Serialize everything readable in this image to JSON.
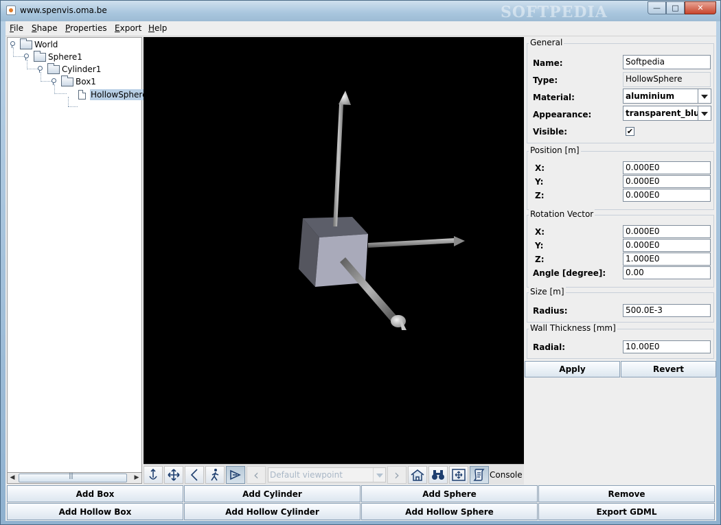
{
  "window": {
    "title": "www.spenvis.oma.be",
    "watermark": "SOFTPEDIA",
    "min_glyph": "—",
    "max_glyph": "□",
    "close_glyph": "✕"
  },
  "menu": [
    {
      "label": "File",
      "mnemonic": "F",
      "rest": "ile"
    },
    {
      "label": "Shape",
      "mnemonic": "S",
      "rest": "hape"
    },
    {
      "label": "Properties",
      "mnemonic": "P",
      "rest": "roperties"
    },
    {
      "label": "Export",
      "mnemonic": "E",
      "rest": "xport"
    },
    {
      "label": "Help",
      "mnemonic": "H",
      "rest": "elp"
    }
  ],
  "tree": {
    "nodes": [
      {
        "label": "World"
      },
      {
        "label": "Sphere1"
      },
      {
        "label": "Cylinder1"
      },
      {
        "label": "Box1"
      },
      {
        "label": "HollowSphere",
        "selected": true
      }
    ],
    "scroll_left": "◀",
    "scroll_right": "▶"
  },
  "nav": {
    "viewpoint_placeholder": "Default viewpoint",
    "prev_glyph": "‹",
    "next_glyph": "›",
    "console_label": "Console"
  },
  "props": {
    "general": {
      "title": "General",
      "name_label": "Name:",
      "name_value": "Softpedia",
      "type_label": "Type:",
      "type_value": "HollowSphere",
      "material_label": "Material:",
      "material_value": "aluminium",
      "appearance_label": "Appearance:",
      "appearance_value": "transparent_blue",
      "visible_label": "Visible:",
      "visible_check": "✔"
    },
    "position": {
      "title": "Position [m]",
      "x_label": "X:",
      "x_value": "0.000E0",
      "y_label": "Y:",
      "y_value": "0.000E0",
      "z_label": "Z:",
      "z_value": "0.000E0"
    },
    "rotation": {
      "title": "Rotation Vector",
      "x_label": "X:",
      "x_value": "0.000E0",
      "y_label": "Y:",
      "y_value": "0.000E0",
      "z_label": "Z:",
      "z_value": "1.000E0",
      "angle_label": "Angle [degree]:",
      "angle_value": "0.00"
    },
    "size": {
      "title": "Size [m]",
      "radius_label": "Radius:",
      "radius_value": "500.0E-3"
    },
    "wall": {
      "title": "Wall Thickness [mm]",
      "radial_label": "Radial:",
      "radial_value": "10.00E0"
    },
    "apply_label": "Apply",
    "revert_label": "Revert"
  },
  "bottom": {
    "add_box": "Add Box",
    "add_cylinder": "Add Cylinder",
    "add_sphere": "Add Sphere",
    "remove": "Remove",
    "add_hollow_box": "Add Hollow Box",
    "add_hollow_cylinder": "Add Hollow Cylinder",
    "add_hollow_sphere": "Add Hollow Sphere",
    "export_gdml": "Export GDML"
  },
  "colors": {
    "viewport_bg": "#000000",
    "selection": "#b8cfe5",
    "axis_gray": "#a8a8a8",
    "box_face": "#a7a9b8"
  }
}
